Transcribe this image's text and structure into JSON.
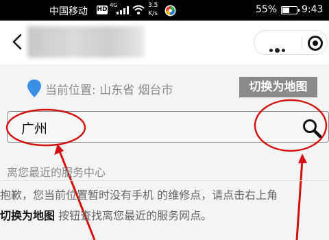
{
  "status_bar": {
    "carrier": "中国移动",
    "hd": "HD",
    "network": "4G",
    "speed_value": "3.5",
    "speed_unit": "K/s",
    "battery_percent": "55%",
    "battery_level": 0.55,
    "time": "9:43"
  },
  "nav": {
    "back_icon": "chevron-left-icon",
    "more_icon": "more-dots-icon",
    "close_icon": "target-close-icon"
  },
  "location": {
    "label": "当前位置: 山东省 烟台市",
    "switch_button": "切换为地图"
  },
  "search": {
    "value": "广州",
    "icon": "search-icon"
  },
  "results": {
    "nearest_title": "离您最近的服务中心",
    "notice_line1": "抱歉，您当前位置暂时没有手机 的维修点，请点击右上角",
    "notice_line2_bold": "切换为地图",
    "notice_line2_rest": " 按钮查找离您最近的服务网点。"
  },
  "colors": {
    "annotation": "#d40f0f",
    "pin": "#3a8ee6",
    "switch_bg": "#8a8a8a"
  }
}
